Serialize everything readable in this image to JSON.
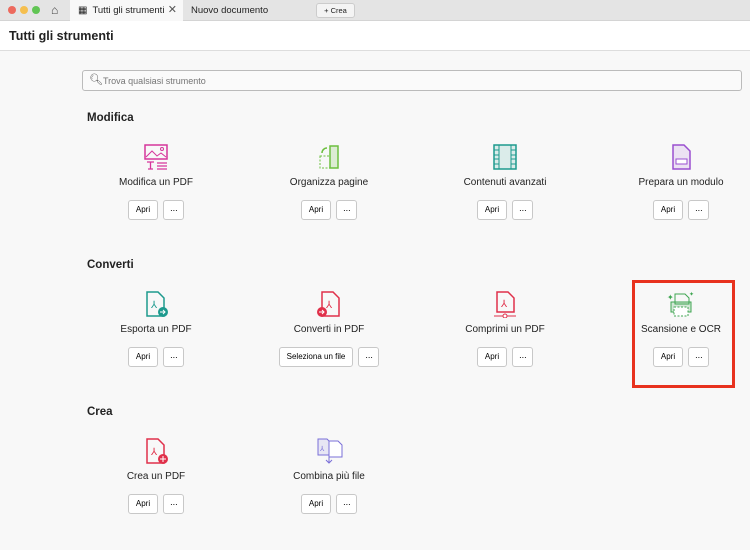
{
  "tabs": {
    "active": "Tutti gli strumenti",
    "second": "Nuovo documento",
    "new_label": "Crea"
  },
  "header": {
    "title": "Tutti gli strumenti"
  },
  "search": {
    "placeholder": "Trova qualsiasi strumento"
  },
  "sections": [
    {
      "title": "Modifica",
      "tools": [
        {
          "label": "Modifica un PDF",
          "button": "Apri",
          "icon": "edit-pdf-icon",
          "color": "#d6359b"
        },
        {
          "label": "Organizza pagine",
          "button": "Apri",
          "icon": "organize-pages-icon",
          "color": "#6cbf3f"
        },
        {
          "label": "Contenuti avanzati",
          "button": "Apri",
          "icon": "rich-media-icon",
          "color": "#1d9a8e"
        },
        {
          "label": "Prepara un modulo",
          "button": "Apri",
          "icon": "prepare-form-icon",
          "color": "#9a4fd0"
        }
      ]
    },
    {
      "title": "Converti",
      "tools": [
        {
          "label": "Esporta un PDF",
          "button": "Apri",
          "icon": "export-pdf-icon",
          "color": "#1d9a8e"
        },
        {
          "label": "Converti in PDF",
          "button": "Seleziona un file",
          "icon": "convert-pdf-icon",
          "color": "#e0304a"
        },
        {
          "label": "Comprimi un PDF",
          "button": "Apri",
          "icon": "compress-pdf-icon",
          "color": "#e0304a"
        },
        {
          "label": "Scansione e OCR",
          "button": "Apri",
          "icon": "scan-ocr-icon",
          "color": "#3fa652"
        }
      ]
    },
    {
      "title": "Crea",
      "tools": [
        {
          "label": "Crea un PDF",
          "button": "Apri",
          "icon": "create-pdf-icon",
          "color": "#e0304a"
        },
        {
          "label": "Combina più file",
          "button": "Apri",
          "icon": "combine-files-icon",
          "color": "#7a6fd8"
        }
      ]
    }
  ],
  "more_label": "···",
  "highlight_color": "#e8321e"
}
